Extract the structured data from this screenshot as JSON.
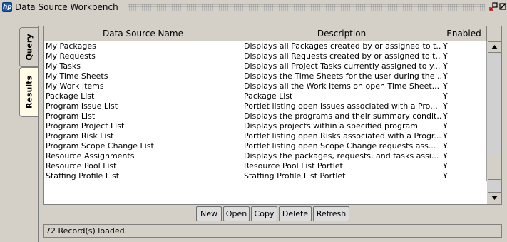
{
  "window": {
    "title": "Data Source Workbench",
    "app_icon": "hp-logo-icon"
  },
  "tabs": [
    {
      "label": "Query",
      "active": false
    },
    {
      "label": "Results",
      "active": true
    }
  ],
  "table": {
    "columns": [
      "Data Source Name",
      "Description",
      "Enabled"
    ],
    "rows": [
      {
        "name": "My Packages",
        "description": "Displays all Packages created by or assigned to t...",
        "enabled": "Y"
      },
      {
        "name": "My Requests",
        "description": "Displays all Requests created by or assigned to t...",
        "enabled": "Y"
      },
      {
        "name": "My Tasks",
        "description": "Displays all Project Tasks currently assigned to y...",
        "enabled": "Y"
      },
      {
        "name": "My Time Sheets",
        "description": "Displays the Time Sheets for the user during the ...",
        "enabled": "Y"
      },
      {
        "name": "My Work Items",
        "description": "Displays all the Work Items on open Time Sheet...",
        "enabled": "Y"
      },
      {
        "name": "Package List",
        "description": "Package List",
        "enabled": "Y"
      },
      {
        "name": "Program Issue List",
        "description": "Portlet listing open issues associated with a Pro...",
        "enabled": "Y"
      },
      {
        "name": "Program List",
        "description": "Displays the programs and their summary condit...",
        "enabled": "Y"
      },
      {
        "name": "Program Project List",
        "description": "Displays projects within a specified program",
        "enabled": "Y"
      },
      {
        "name": "Program Risk List",
        "description": "Portlet listing open Risks associated with a Progr...",
        "enabled": "Y"
      },
      {
        "name": "Program Scope Change List",
        "description": "Portlet listing open Scope Change requests ass...",
        "enabled": "Y"
      },
      {
        "name": "Resource Assignments",
        "description": "Displays the packages, requests, and tasks assi...",
        "enabled": "Y"
      },
      {
        "name": "Resource Pool List",
        "description": "Resource Pool List Portlet",
        "enabled": "Y"
      },
      {
        "name": "Staffing Profile List",
        "description": "Staffing Profile List Portlet",
        "enabled": "Y"
      }
    ]
  },
  "buttons": {
    "new": "New",
    "open": "Open",
    "copy": "Copy",
    "delete": "Delete",
    "refresh": "Refresh"
  },
  "status": {
    "text": "72 Record(s) loaded."
  },
  "colors": {
    "chrome": "#d4d0c8",
    "active_tab": "#fffbe6",
    "icon_blue": "#1f5aa6"
  }
}
